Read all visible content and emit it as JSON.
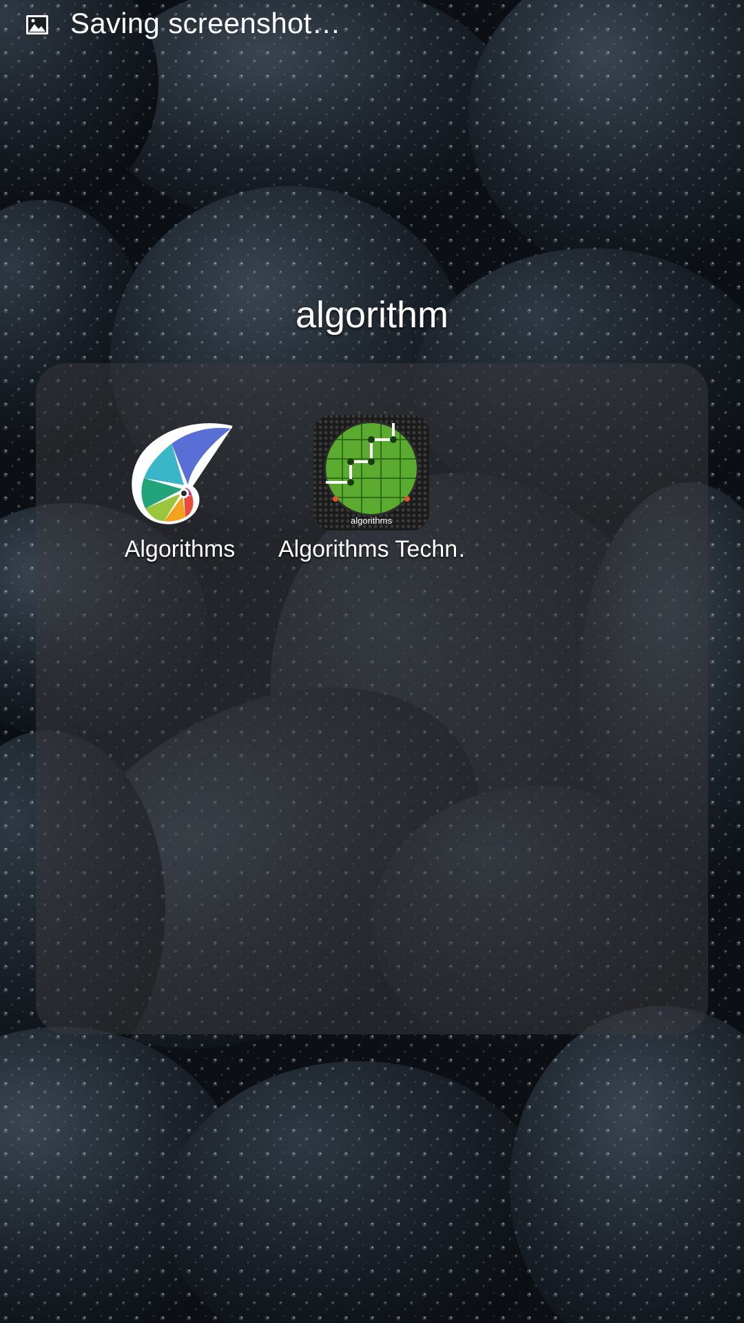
{
  "status_bar": {
    "icon": "image-icon",
    "text": "Saving screenshot…"
  },
  "folder": {
    "title": "algorithm",
    "apps": [
      {
        "label": "Algorithms",
        "icon": "spiral-shell-icon"
      },
      {
        "label": "Algorithms Techn…",
        "icon": "green-grid-path-icon",
        "icon_caption": "algorithms"
      }
    ]
  },
  "colors": {
    "wallpaper": "#12171d",
    "folder_panel": "#3a3a3e",
    "text": "#ffffff",
    "grid_green": "#5aab2f"
  }
}
